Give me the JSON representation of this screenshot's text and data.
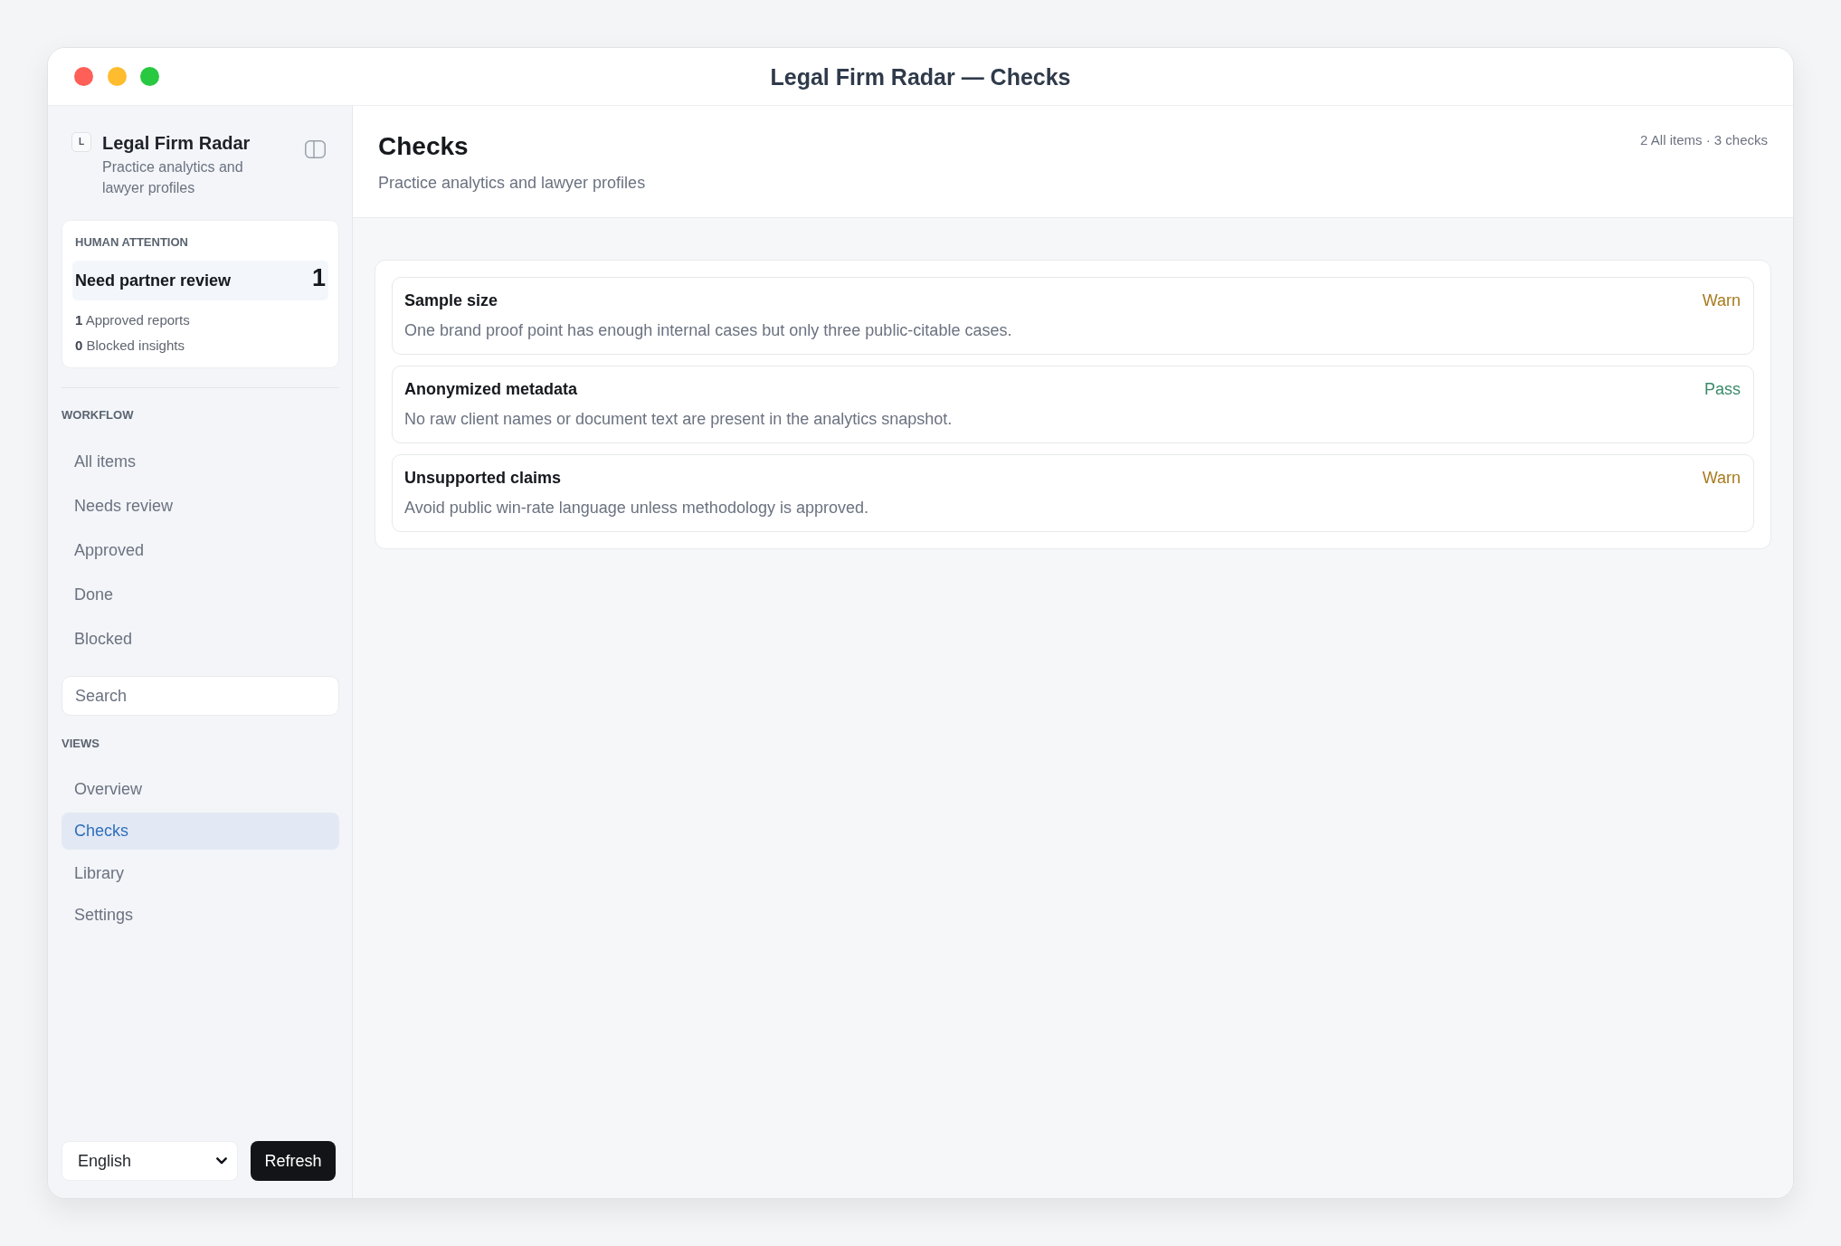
{
  "window": {
    "title": "Legal Firm Radar — Checks"
  },
  "sidebar": {
    "brand": {
      "logo": "L",
      "name": "Legal Firm Radar",
      "tagline": "Practice analytics and lawyer profiles"
    },
    "attention": {
      "heading": "HUMAN ATTENTION",
      "highlight": {
        "label": "Need partner review",
        "count": "1"
      },
      "stats": [
        "**1** Approved reports",
        "**0** Blocked insights"
      ]
    },
    "workflow": {
      "heading": "WORKFLOW",
      "items": [
        {
          "label": "All items",
          "selected": false
        },
        {
          "label": "Needs review",
          "selected": false
        },
        {
          "label": "Approved",
          "selected": false
        },
        {
          "label": "Done",
          "selected": false
        },
        {
          "label": "Blocked",
          "selected": false
        }
      ]
    },
    "search": {
      "placeholder": "Search"
    },
    "views": {
      "heading": "VIEWS",
      "items": [
        {
          "label": "Overview",
          "selected": false
        },
        {
          "label": "Checks",
          "selected": true
        },
        {
          "label": "Library",
          "selected": false
        },
        {
          "label": "Settings",
          "selected": false
        }
      ]
    },
    "language": {
      "value": "English"
    },
    "refresh_button": {
      "label": "Refresh"
    }
  },
  "main": {
    "title": "Checks",
    "subtitle": "Practice analytics and lawyer profiles",
    "summary": "2 All items · 3 checks",
    "checks": [
      {
        "title": "Sample size",
        "description": "One brand proof point has enough internal cases but only three public-citable cases.",
        "status": "Warn",
        "color": "#a87b1e"
      },
      {
        "title": "Anonymized metadata",
        "description": "No raw client names or document text are present in the analytics snapshot.",
        "status": "Pass",
        "color": "#3a8a6a"
      },
      {
        "title": "Unsupported claims",
        "description": "Avoid public win-rate language unless methodology is approved.",
        "status": "Warn",
        "color": "#a87b1e"
      }
    ]
  }
}
